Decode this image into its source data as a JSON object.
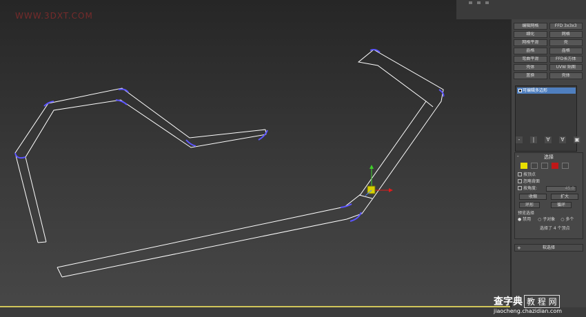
{
  "viewport": {
    "watermark_top": "WWW.3DXT.COM",
    "colors": {
      "spline": "#ffffff",
      "selected_vertex": "#5c55ff",
      "gizmo_x": "#e21b1b",
      "gizmo_y": "#3fd02a",
      "gizmo_box": "#d7d000"
    }
  },
  "modifier_list": {
    "rows": [
      [
        "编辑网格",
        "FFD 3x3x3"
      ],
      [
        "细化",
        "网格"
      ],
      [
        "网格平滑",
        "壳"
      ],
      [
        "晶格",
        "晶格"
      ],
      [
        "弯曲平滑",
        "FFD长方体"
      ],
      [
        "壳体",
        "UVW 贴图"
      ],
      [
        "置换",
        "壳体"
      ]
    ]
  },
  "stack": {
    "item_label": "可编辑多边形"
  },
  "stack_tools": [
    "-",
    "|",
    "∀",
    "∀",
    "▣"
  ],
  "selection": {
    "header": "选择",
    "minus": "-",
    "by_vertex": "按顶点",
    "ignore_backface": "忽略背面",
    "by_angle": "按角度:",
    "angle_value": "45.0",
    "shrink": "收缩",
    "grow": "扩大",
    "ring": "环形",
    "loop": "循环",
    "preview": "预览选择",
    "preview_off": "禁用",
    "preview_sub": "子对象",
    "preview_multi": "多个",
    "status": "选择了 4 个顶点"
  },
  "soft_selection": {
    "plus": "+",
    "label": "软选择"
  },
  "watermark": {
    "logo_main": "查字典",
    "logo_box": "教 程 网",
    "url": "jiaocheng.chazidian.com"
  }
}
